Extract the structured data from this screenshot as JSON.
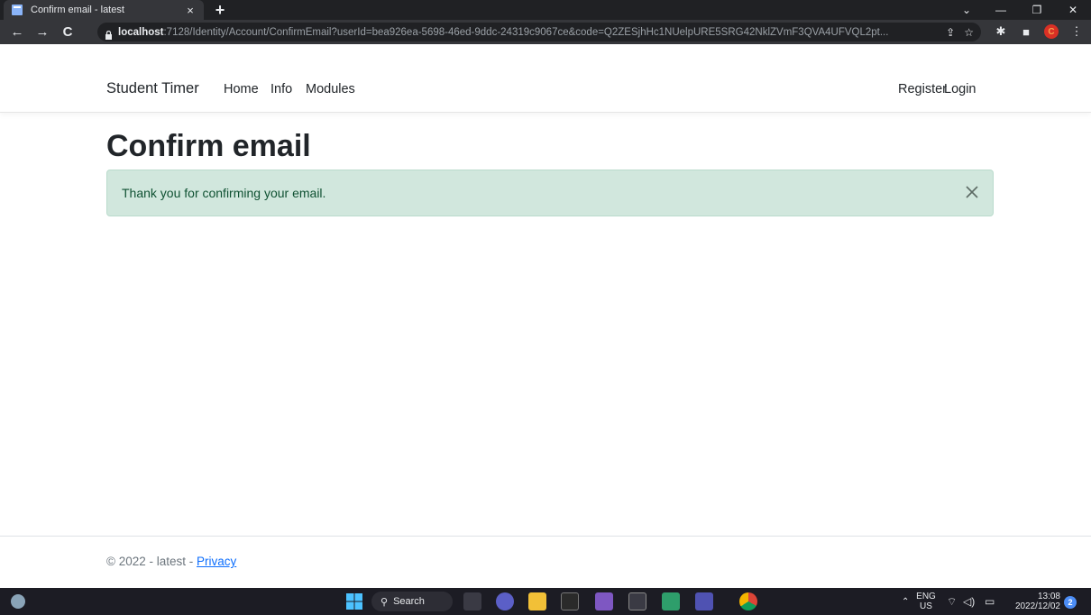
{
  "browser": {
    "tab_title": "Confirm email - latest",
    "tab_close": "×",
    "new_tab": "+",
    "url_host": "localhost",
    "url_rest": ":7128/Identity/Account/ConfirmEmail?userId=bea926ea-5698-46ed-9ddc-24319c9067ce&code=Q2ZESjhHc1NUelpURE5SRG42NklZVmF3QVA4UFVQL2pt..."
  },
  "navbar": {
    "brand": "Student Timer",
    "links": [
      "Home",
      "Info",
      "Modules"
    ],
    "right_links": [
      "Register",
      "Login"
    ]
  },
  "main": {
    "title": "Confirm email",
    "alert_text": "Thank you for confirming your email."
  },
  "footer": {
    "text": "© 2022 - latest - ",
    "link": "Privacy"
  },
  "taskbar": {
    "search_label": "Search",
    "lang_top": "ENG",
    "lang_bottom": "US",
    "time": "13:08",
    "date": "2022/12/02",
    "notification_count": "2"
  },
  "colors": {
    "alert_bg": "#d1e7dd",
    "alert_text": "#0f5132",
    "link": "#0d6efd"
  }
}
